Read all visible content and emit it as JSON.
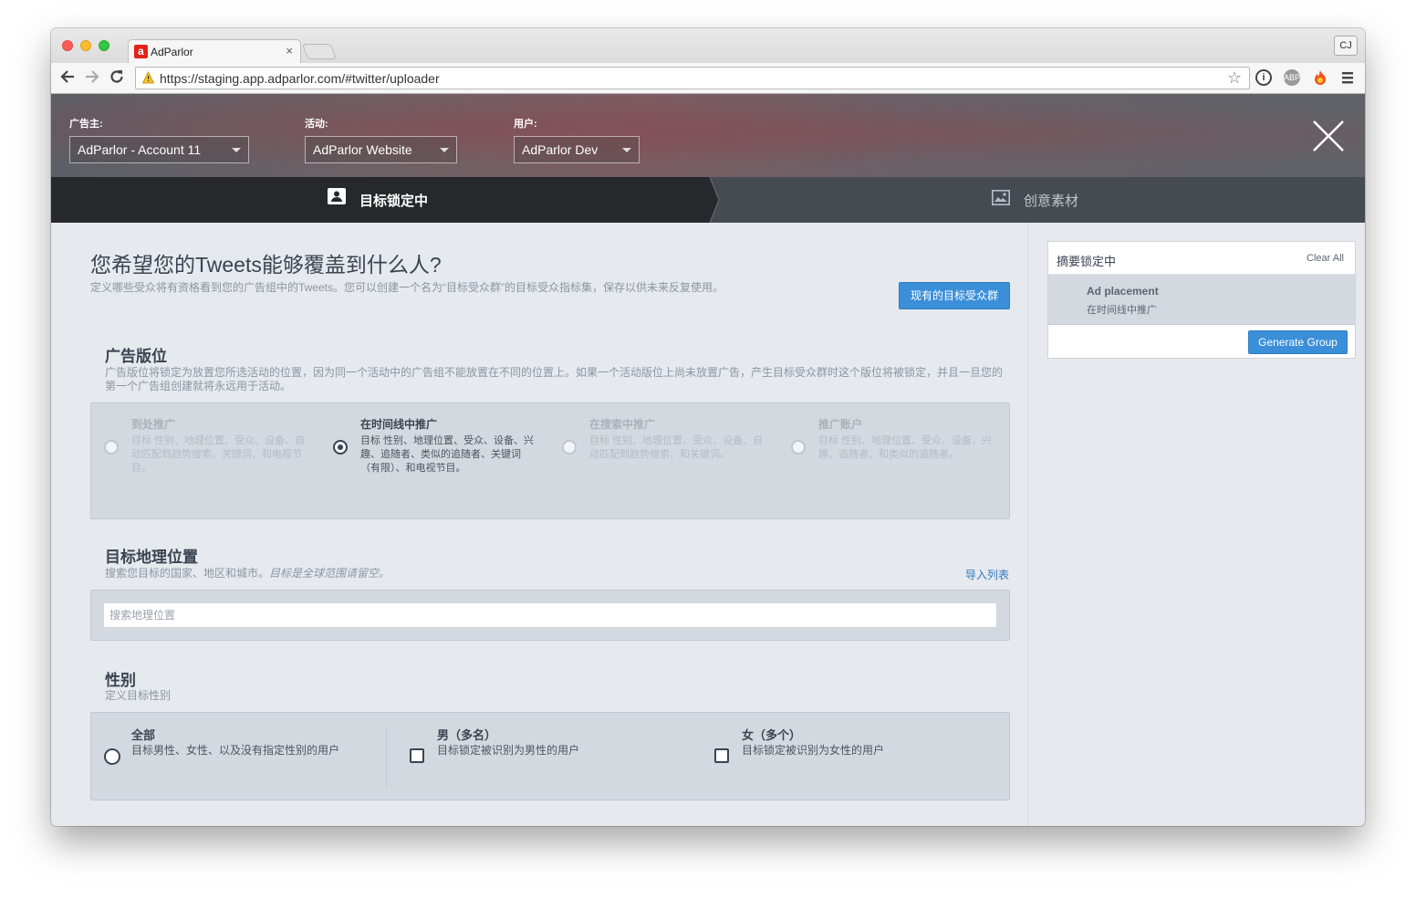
{
  "browser": {
    "tab_title": "AdParlor",
    "tab_favicon_letter": "a",
    "tab_close": "×",
    "url": "https://staging.app.adparlor.com/#twitter/uploader",
    "profile": "CJ",
    "ext_abp": "ABP"
  },
  "header": {
    "advertiser_label": "广告主:",
    "advertiser_value": "AdParlor - Account 11",
    "campaign_label": "活动:",
    "campaign_value": "AdParlor Website",
    "user_label": "用户:",
    "user_value": "AdParlor Dev"
  },
  "steps": {
    "targeting": "目标锁定中",
    "creative": "创意素材"
  },
  "main": {
    "title": "您希望您的Tweets能够覆盖到什么人?",
    "description": "定义哪些受众将有资格看到您的广告组中的Tweets。您可以创建一个名为“目标受众群”的目标受众指标集，保存以供未来反复使用。",
    "existing_audience_button": "现有的目标受众群"
  },
  "placement": {
    "title": "广告版位",
    "description": "广告版位将锁定为放置您所选活动的位置，因为同一个活动中的广告组不能放置在不同的位置上。如果一个活动版位上尚未放置广告，产生目标受众群时这个版位将被锁定，并且一旦您的第一个广告组创建就将永远用于活动。",
    "options": [
      {
        "title": "到处推广",
        "desc": "目标 性别、地理位置、受众、设备、自动匹配到趋势搜索、关键词、和电视节目。"
      },
      {
        "title": "在时间线中推广",
        "desc": "目标 性别、地理位置、受众、设备、兴趣、追随者、类似的追随者、关键词（有限）、和电视节目。"
      },
      {
        "title": "在搜索中推广",
        "desc": "目标 性别、地理位置、受众、设备、自动匹配到趋势搜索、和关键词。"
      },
      {
        "title": "推广账户",
        "desc": "目标 性别、地理位置、受众、设备、兴趣、追随者、和类似的追随者。"
      }
    ]
  },
  "geo": {
    "title": "目标地理位置",
    "description": "搜索您目标的国家、地区和城市。",
    "description_italic": "目标是全球范围请留空。",
    "import_link": "导入列表",
    "search_placeholder": "搜索地理位置"
  },
  "gender": {
    "title": "性别",
    "description": "定义目标性别",
    "options": [
      {
        "title": "全部",
        "desc": "目标男性、女性、以及没有指定性别的用户"
      },
      {
        "title": "男（多名）",
        "desc": "目标锁定被识别为男性的用户"
      },
      {
        "title": "女（多个）",
        "desc": "目标锁定被识别为女性的用户"
      }
    ]
  },
  "summary": {
    "title": "摘要锁定中",
    "clear_all": "Clear All",
    "item_title": "Ad placement",
    "item_value": "在时间线中推广",
    "generate_button": "Generate Group"
  },
  "colors": {
    "accent_blue": "#3b8fd9",
    "header_dark": "#26282b",
    "text_dark": "#3a4452"
  }
}
